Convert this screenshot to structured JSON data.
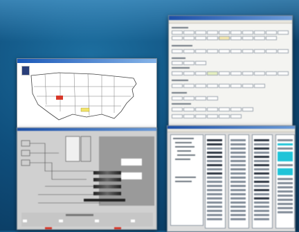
{
  "screenshots": [
    {
      "name": "us-map-window"
    },
    {
      "name": "form-window"
    },
    {
      "name": "block-diagram-window"
    },
    {
      "name": "list-columns-window"
    }
  ],
  "colors": {
    "background": "#0f4f7d",
    "title_bar": "#1c4fa8",
    "highlight_red": "#d8382a",
    "highlight_yellow": "#f2e46a",
    "accent_cyan": "#1fc4d8"
  }
}
